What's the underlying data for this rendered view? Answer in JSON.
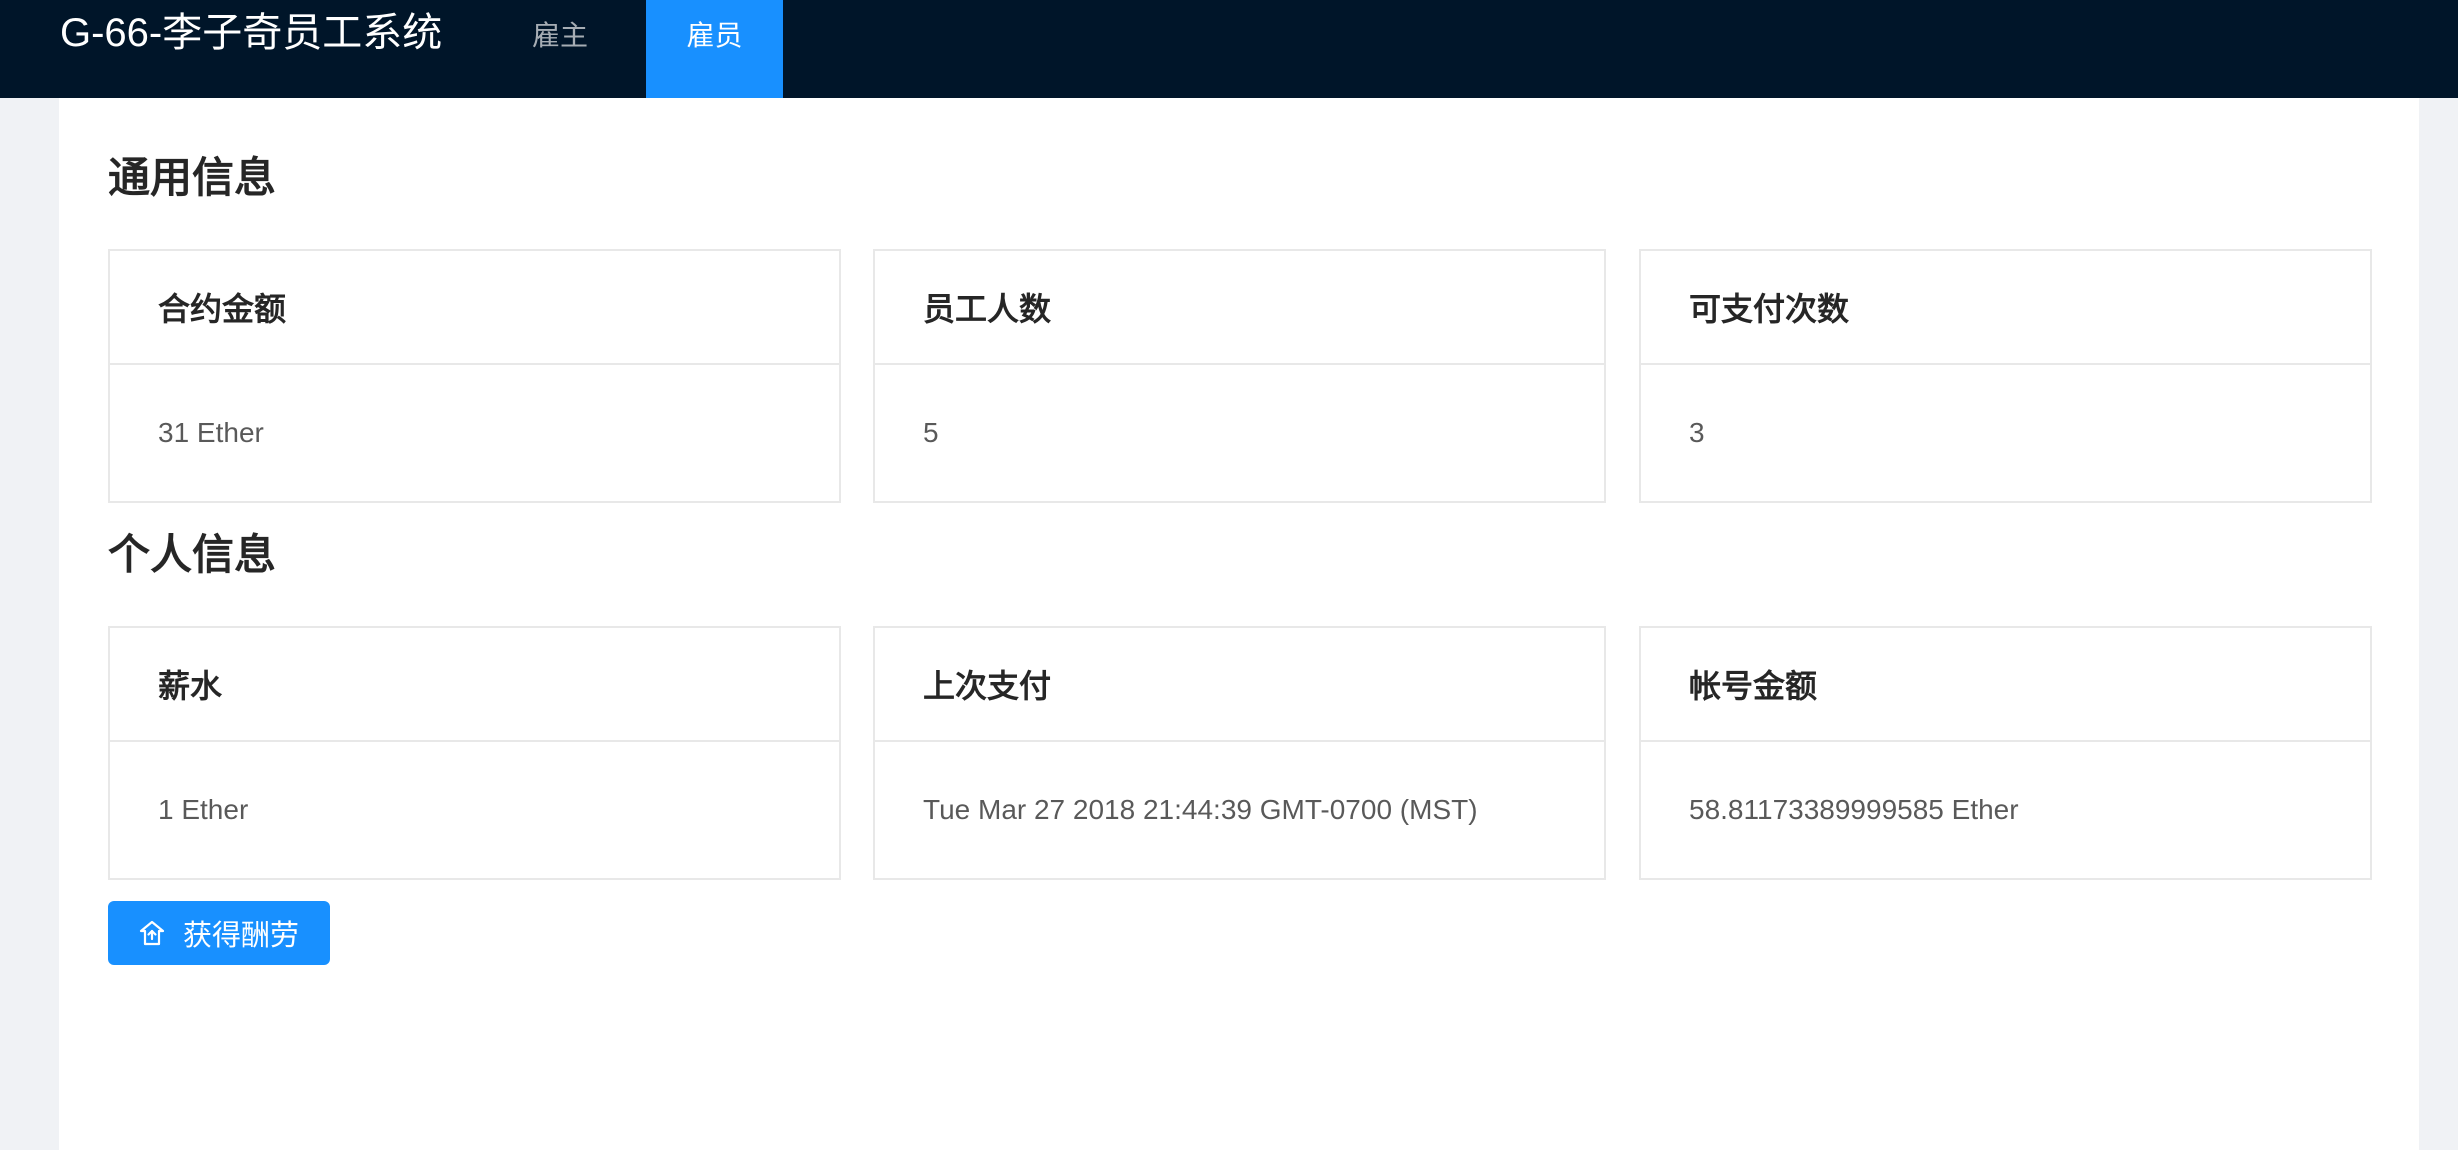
{
  "header": {
    "title": "G-66-李子奇员工系统",
    "tabs": [
      {
        "label": "雇主",
        "active": false
      },
      {
        "label": "雇员",
        "active": true
      }
    ]
  },
  "general": {
    "title": "通用信息",
    "cards": [
      {
        "title": "合约金额",
        "value": "31 Ether"
      },
      {
        "title": "员工人数",
        "value": "5"
      },
      {
        "title": "可支付次数",
        "value": "3"
      }
    ]
  },
  "personal": {
    "title": "个人信息",
    "cards": [
      {
        "title": "薪水",
        "value": "1 Ether"
      },
      {
        "title": "上次支付",
        "value": "Tue Mar 27 2018 21:44:39 GMT-0700 (MST)"
      },
      {
        "title": "帐号金额",
        "value": "58.81173389999585 Ether"
      }
    ]
  },
  "actions": {
    "get_pay_label": "获得酬劳",
    "get_pay_icon": "upload-icon"
  },
  "colors": {
    "header_bg": "#001529",
    "accent": "#1890ff",
    "page_bg": "#f0f2f5"
  }
}
